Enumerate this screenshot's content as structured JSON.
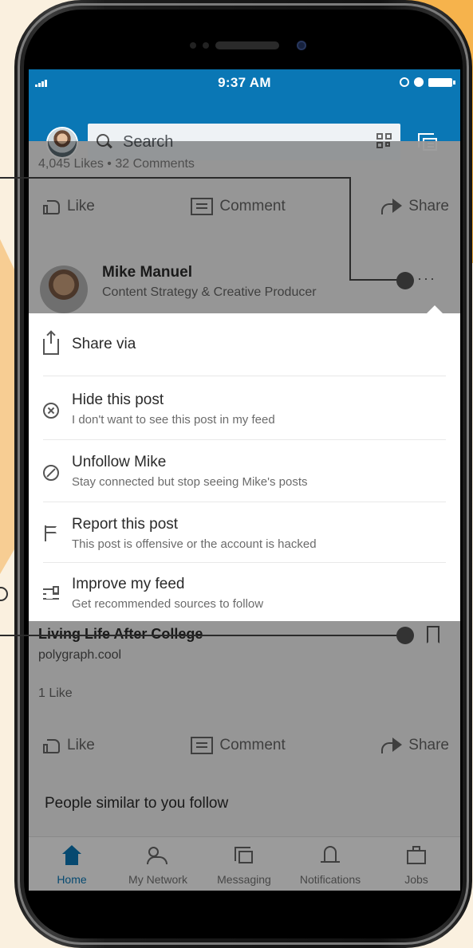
{
  "status_bar": {
    "time": "9:37 AM"
  },
  "search": {
    "placeholder": "Search"
  },
  "previous_post": {
    "counts": "4,045 Likes • 32 Comments",
    "actions": {
      "like": "Like",
      "comment": "Comment",
      "share": "Share"
    }
  },
  "post": {
    "author_name": "Mike Manuel",
    "author_title": "Content Strategy & Creative Producer",
    "more_label": "···"
  },
  "menu": {
    "items": [
      {
        "title": "Share via",
        "subtitle": ""
      },
      {
        "title": "Hide this post",
        "subtitle": "I don't want to see this post in my feed"
      },
      {
        "title": "Unfollow Mike",
        "subtitle": "Stay connected but stop seeing Mike's posts"
      },
      {
        "title": "Report this post",
        "subtitle": "This post is offensive or the account is hacked"
      },
      {
        "title": "Improve my feed",
        "subtitle": "Get recommended sources to follow"
      }
    ]
  },
  "article": {
    "title": "Living Life After College",
    "source": "polygraph.cool",
    "likes": "1 Like",
    "actions": {
      "like": "Like",
      "comment": "Comment",
      "share": "Share"
    }
  },
  "section": {
    "people_similar": "People similar to you follow"
  },
  "tabs": [
    {
      "label": "Home",
      "icon": "home-icon",
      "active": true
    },
    {
      "label": "My Network",
      "icon": "network-icon"
    },
    {
      "label": "Messaging",
      "icon": "messaging-icon"
    },
    {
      "label": "Notifications",
      "icon": "bell-icon"
    },
    {
      "label": "Jobs",
      "icon": "briefcase-icon"
    }
  ],
  "colors": {
    "brand": "#0a77b5",
    "background": "#faf0df",
    "accent": "#f6b34c"
  }
}
